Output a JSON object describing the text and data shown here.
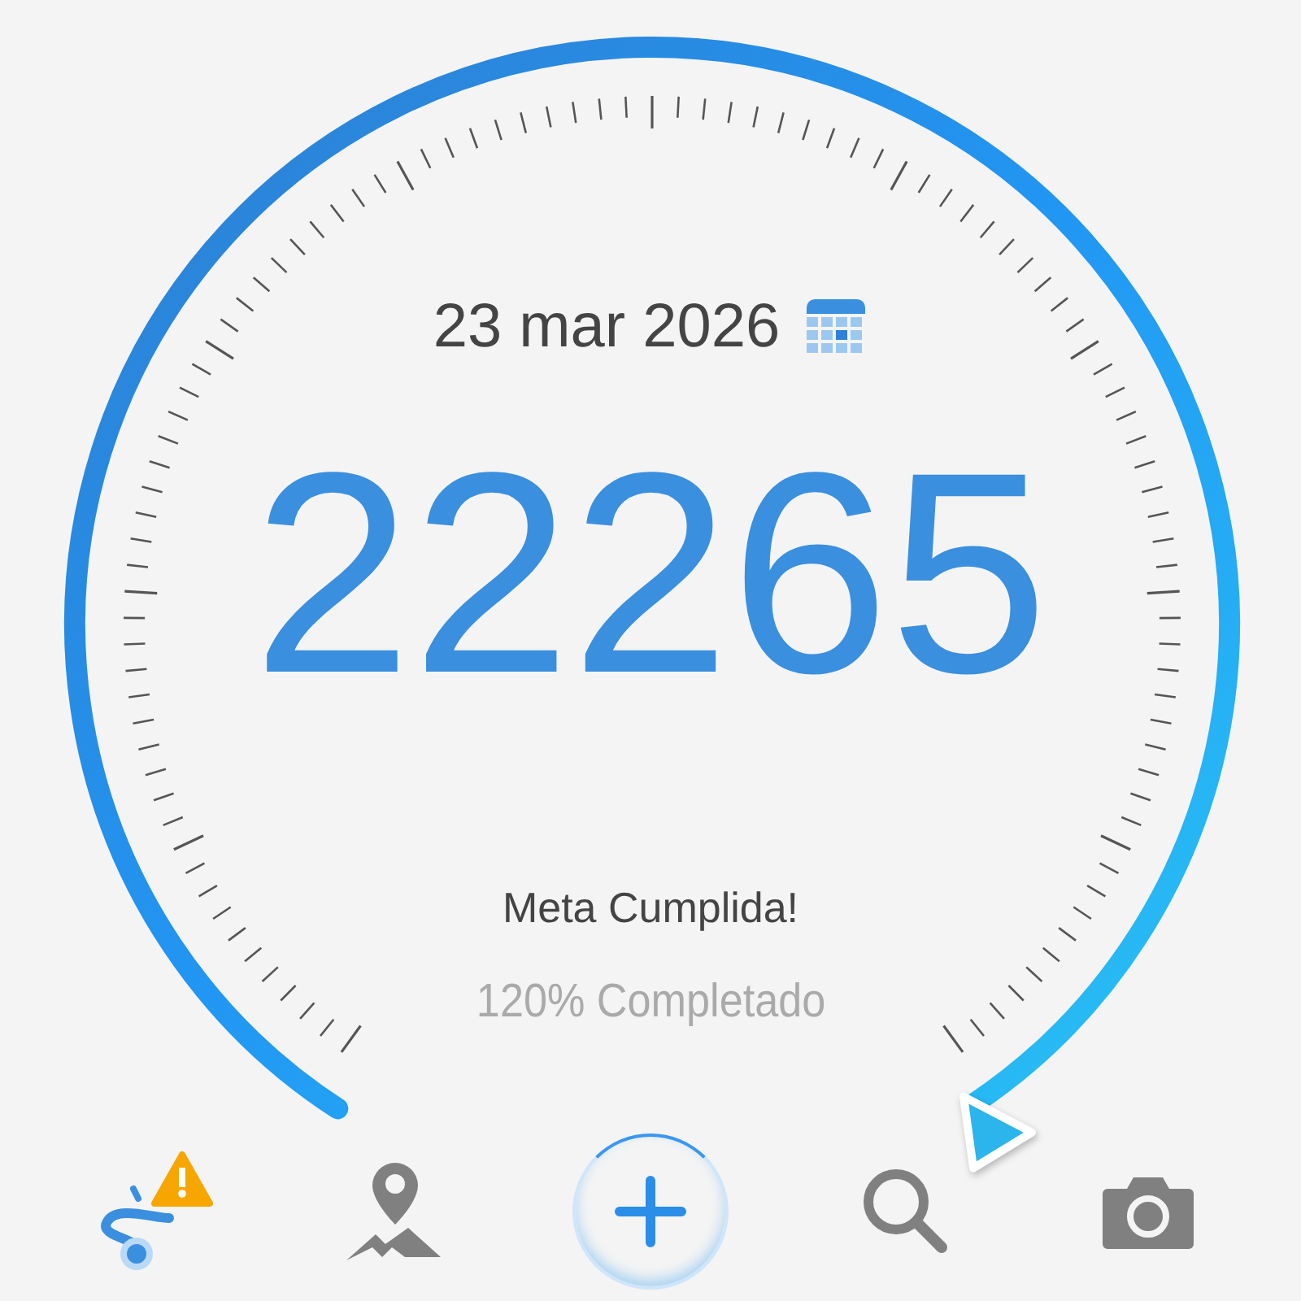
{
  "date": "23 mar 2026",
  "steps": "22265",
  "status": "Meta Cumplida!",
  "progress": "120% Completado",
  "nav": [
    {
      "kind": "route"
    },
    {
      "kind": "map"
    },
    {
      "kind": "add"
    },
    {
      "kind": "search"
    },
    {
      "kind": "camera"
    }
  ]
}
